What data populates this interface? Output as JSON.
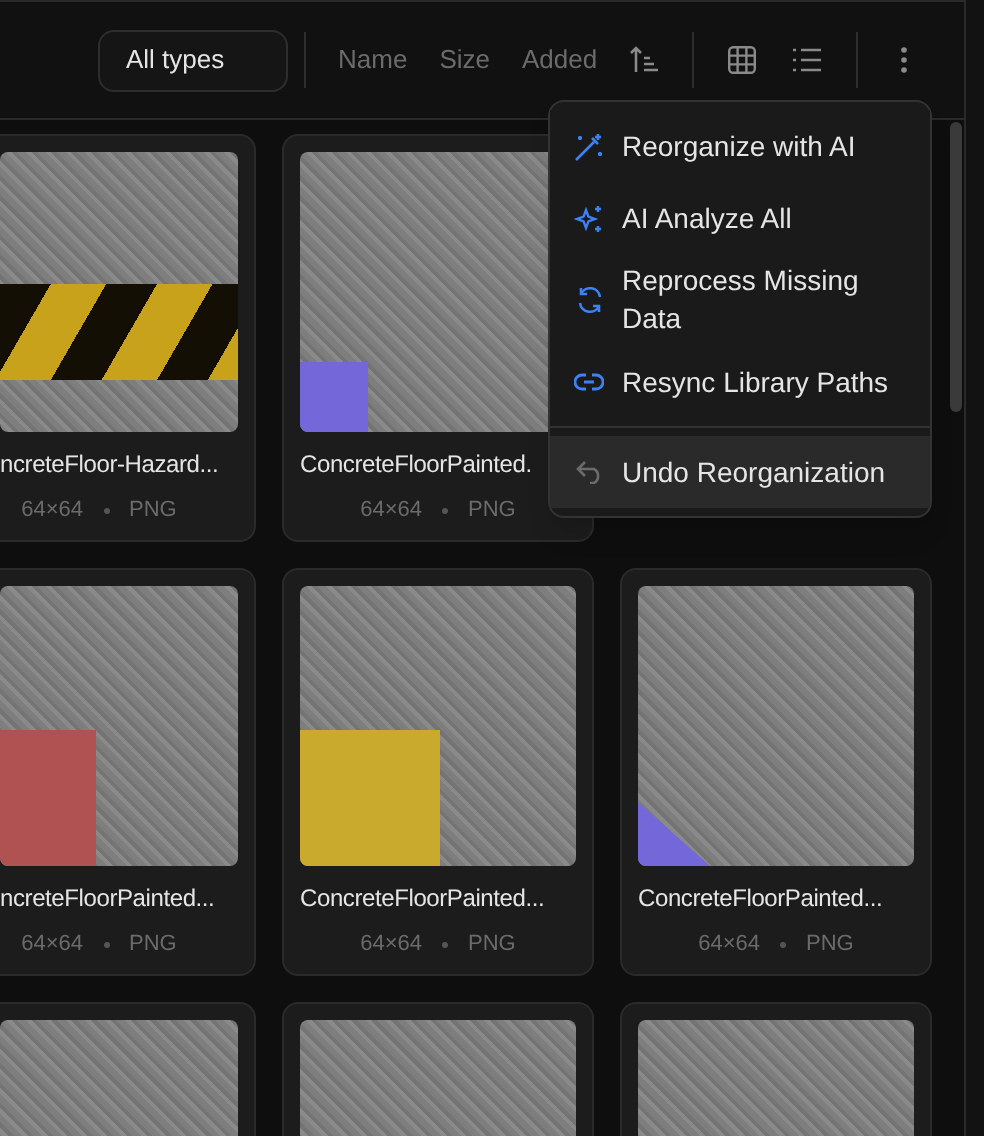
{
  "toolbar": {
    "type_filter": "All types",
    "sort_options": [
      {
        "label": "Name",
        "selected": false
      },
      {
        "label": "Size",
        "selected": false
      },
      {
        "label": "Added",
        "selected": false
      }
    ],
    "view_modes": [
      {
        "kind": "grid",
        "selected": false
      },
      {
        "kind": "list",
        "selected": false
      }
    ]
  },
  "menu": {
    "items": [
      {
        "label": "Reorganize with AI",
        "kind": "wand",
        "highlighted": false
      },
      {
        "label": "AI Analyze All",
        "kind": "sparkles",
        "highlighted": false
      },
      {
        "label": "Reprocess Missing Data",
        "kind": "refresh",
        "highlighted": false
      },
      {
        "label": "Resync Library Paths",
        "kind": "link",
        "highlighted": false
      },
      {
        "label": "Undo Reorganization",
        "kind": "undo",
        "highlighted": true,
        "separated": true
      }
    ]
  },
  "card_rows": [
    [
      {
        "title": "ncreteFloor-Hazard...",
        "meta": [
          "64×64",
          "PNG"
        ],
        "overlay": {
          "kind": "stripes",
          "color": "#c9a21c"
        }
      },
      {
        "title": "ConcreteFloorPainted.",
        "meta": [
          "64×64",
          "PNG"
        ],
        "overlay": {
          "kind": "corner",
          "color": "#7367d9"
        }
      }
    ],
    [
      {
        "title": "ncreteFloorPainted...",
        "meta": [
          "64×64",
          "PNG"
        ],
        "overlay": {
          "kind": "block",
          "color": "#b05252"
        }
      },
      {
        "title": "ConcreteFloorPainted...",
        "meta": [
          "64×64",
          "PNG"
        ],
        "overlay": {
          "kind": "block",
          "color": "#c9aa2c"
        }
      },
      {
        "title": "ConcreteFloorPainted...",
        "meta": [
          "64×64",
          "PNG"
        ],
        "overlay": {
          "kind": "triangle",
          "color": "#7367d9"
        }
      }
    ],
    [
      {
        "overlay": {
          "kind": "none"
        }
      },
      {
        "overlay": {
          "kind": "none"
        }
      },
      {
        "overlay": {
          "kind": "none"
        }
      }
    ]
  ]
}
